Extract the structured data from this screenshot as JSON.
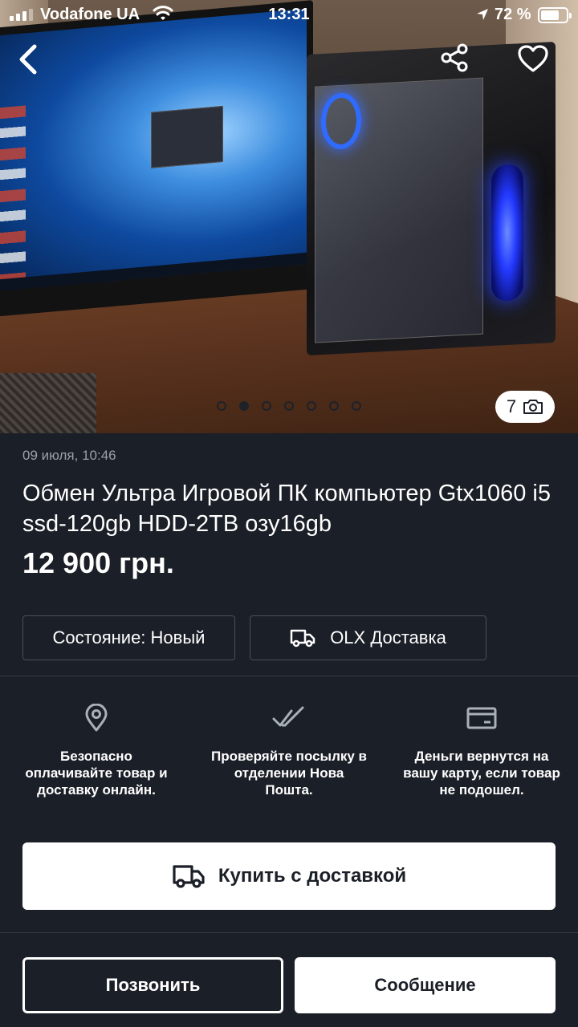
{
  "status_bar": {
    "carrier": "Vodafone UA",
    "time": "13:31",
    "battery_percent": "72 %",
    "battery_level": 0.72
  },
  "gallery": {
    "photo_count": "7",
    "total_dots": 7,
    "active_index": 1
  },
  "listing": {
    "date": "09 июля, 10:46",
    "title": "Обмен Ультра Игровой ПК компьютер Gtx1060 i5 ssd-120gb HDD-2TB озу16gb",
    "price": "12 900 грн.",
    "condition": "Состояние: Новый",
    "delivery": "OLX Доставка"
  },
  "features": [
    {
      "icon": "location-pin-icon",
      "text": "Безопасно оплачивайте товар и доставку онлайн."
    },
    {
      "icon": "double-check-icon",
      "text": "Проверяйте посылку в отделении Нова Пошта."
    },
    {
      "icon": "credit-card-icon",
      "text": "Деньги вернутся на вашу карту, если товар не подошел."
    }
  ],
  "actions": {
    "buy_label": "Купить с доставкой",
    "call_label": "Позвонить",
    "message_label": "Сообщение"
  },
  "colors": {
    "background": "#1b1f27",
    "text": "#ffffff",
    "muted": "#9aa1ab",
    "border": "#4a5059"
  }
}
